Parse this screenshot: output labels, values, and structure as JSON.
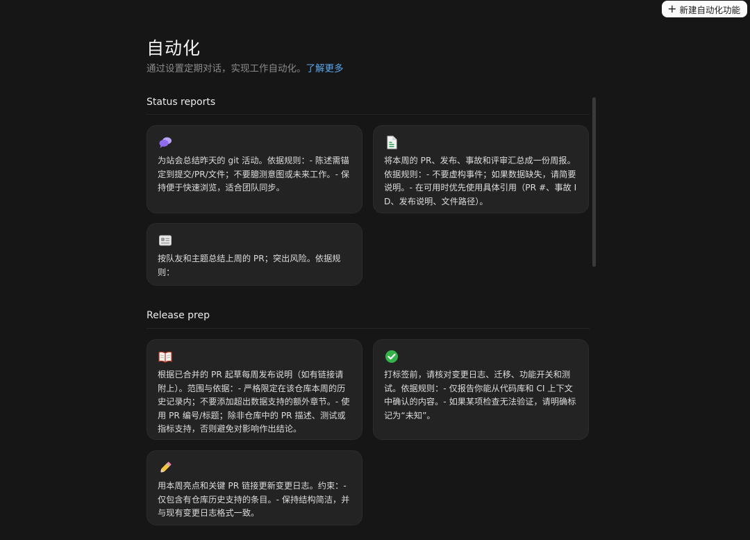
{
  "toolbar": {
    "new_label": "新建自动化功能"
  },
  "header": {
    "title": "自动化",
    "subtitle": "通过设置定期对话，实现工作自动化。",
    "learn_more": "了解更多"
  },
  "sections": [
    {
      "title": "Status reports",
      "cards": [
        {
          "icon": "speech-bubbles-icon",
          "text": "为站会总结昨天的 git 活动。依据规则：- 陈述需锚定到提交/PR/文件；不要臆测意图或未来工作。- 保持便于快速浏览，适合团队同步。"
        },
        {
          "icon": "document-icon",
          "text": "将本周的 PR、发布、事故和评审汇总成一份周报。依据规则：- 不要虚构事件；如果数据缺失，请简要说明。- 在可用时优先使用具体引用（PR #、事故 ID、发布说明、文件路径）。"
        },
        {
          "icon": "id-card-icon",
          "text": "按队友和主题总结上周的 PR；突出风险。依据规则："
        }
      ]
    },
    {
      "title": "Release prep",
      "cards": [
        {
          "icon": "open-book-icon",
          "text": "根据已合并的 PR 起草每周发布说明（如有链接请附上）。范围与依据：- 严格限定在该仓库本周的历史记录内；不要添加超出数据支持的额外章节。- 使用 PR 编号/标题；除非仓库中的 PR 描述、测试或指标支持，否则避免对影响作出结论。"
        },
        {
          "icon": "check-mark-icon",
          "text": "打标签前，请核对变更日志、迁移、功能开关和测试。依据规则：- 仅报告你能从代码库和 CI 上下文中确认的内容。- 如果某项检查无法验证，请明确标记为“未知”。"
        },
        {
          "icon": "pencil-icon",
          "text": "用本周亮点和关键 PR 链接更新变更日志。约束：- 仅包含有仓库历史支持的条目。- 保持结构简洁，并与现有变更日志格式一致。"
        }
      ]
    }
  ],
  "colors": {
    "background": "#161616",
    "card": "#232323",
    "link": "#5aa7ee",
    "check": "#34b34a",
    "bubble": "#9b7cf0"
  }
}
